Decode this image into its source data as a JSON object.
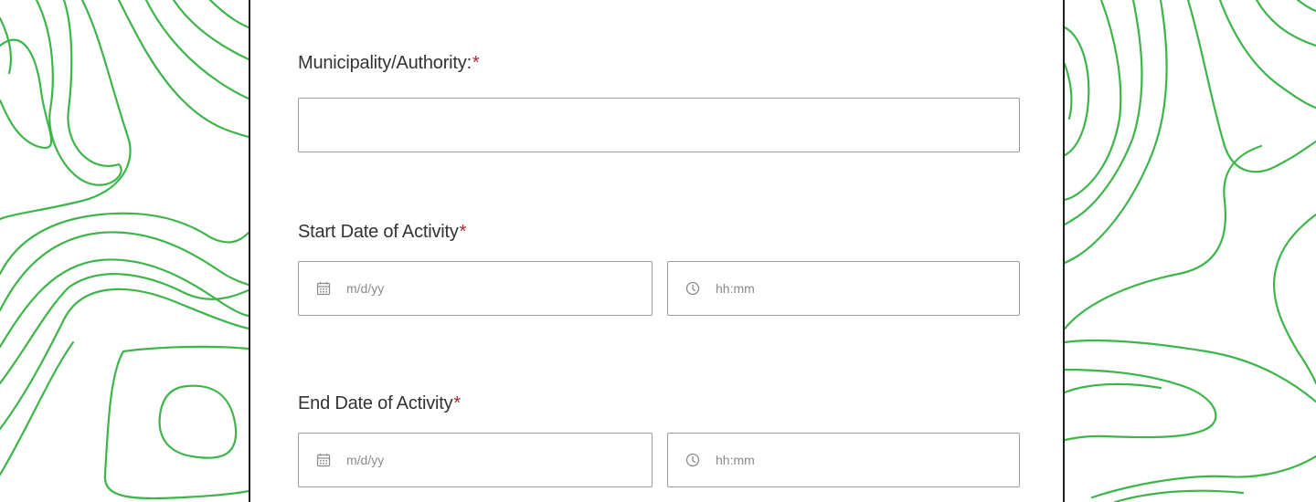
{
  "form": {
    "municipality": {
      "label": "Municipality/Authority:",
      "required_marker": "*",
      "value": ""
    },
    "start": {
      "label": "Start Date of Activity",
      "required_marker": "*",
      "date_placeholder": "m/d/yy",
      "time_placeholder": "hh:mm"
    },
    "end": {
      "label": "End Date of Activity",
      "required_marker": "*",
      "date_placeholder": "m/d/yy",
      "time_placeholder": "hh:mm"
    }
  },
  "icons": {
    "date": "calendar-icon",
    "time": "clock-icon"
  },
  "colors": {
    "contour": "#3db54a",
    "required": "#a8282b",
    "border": "#9c9c9c",
    "text": "#323232"
  }
}
